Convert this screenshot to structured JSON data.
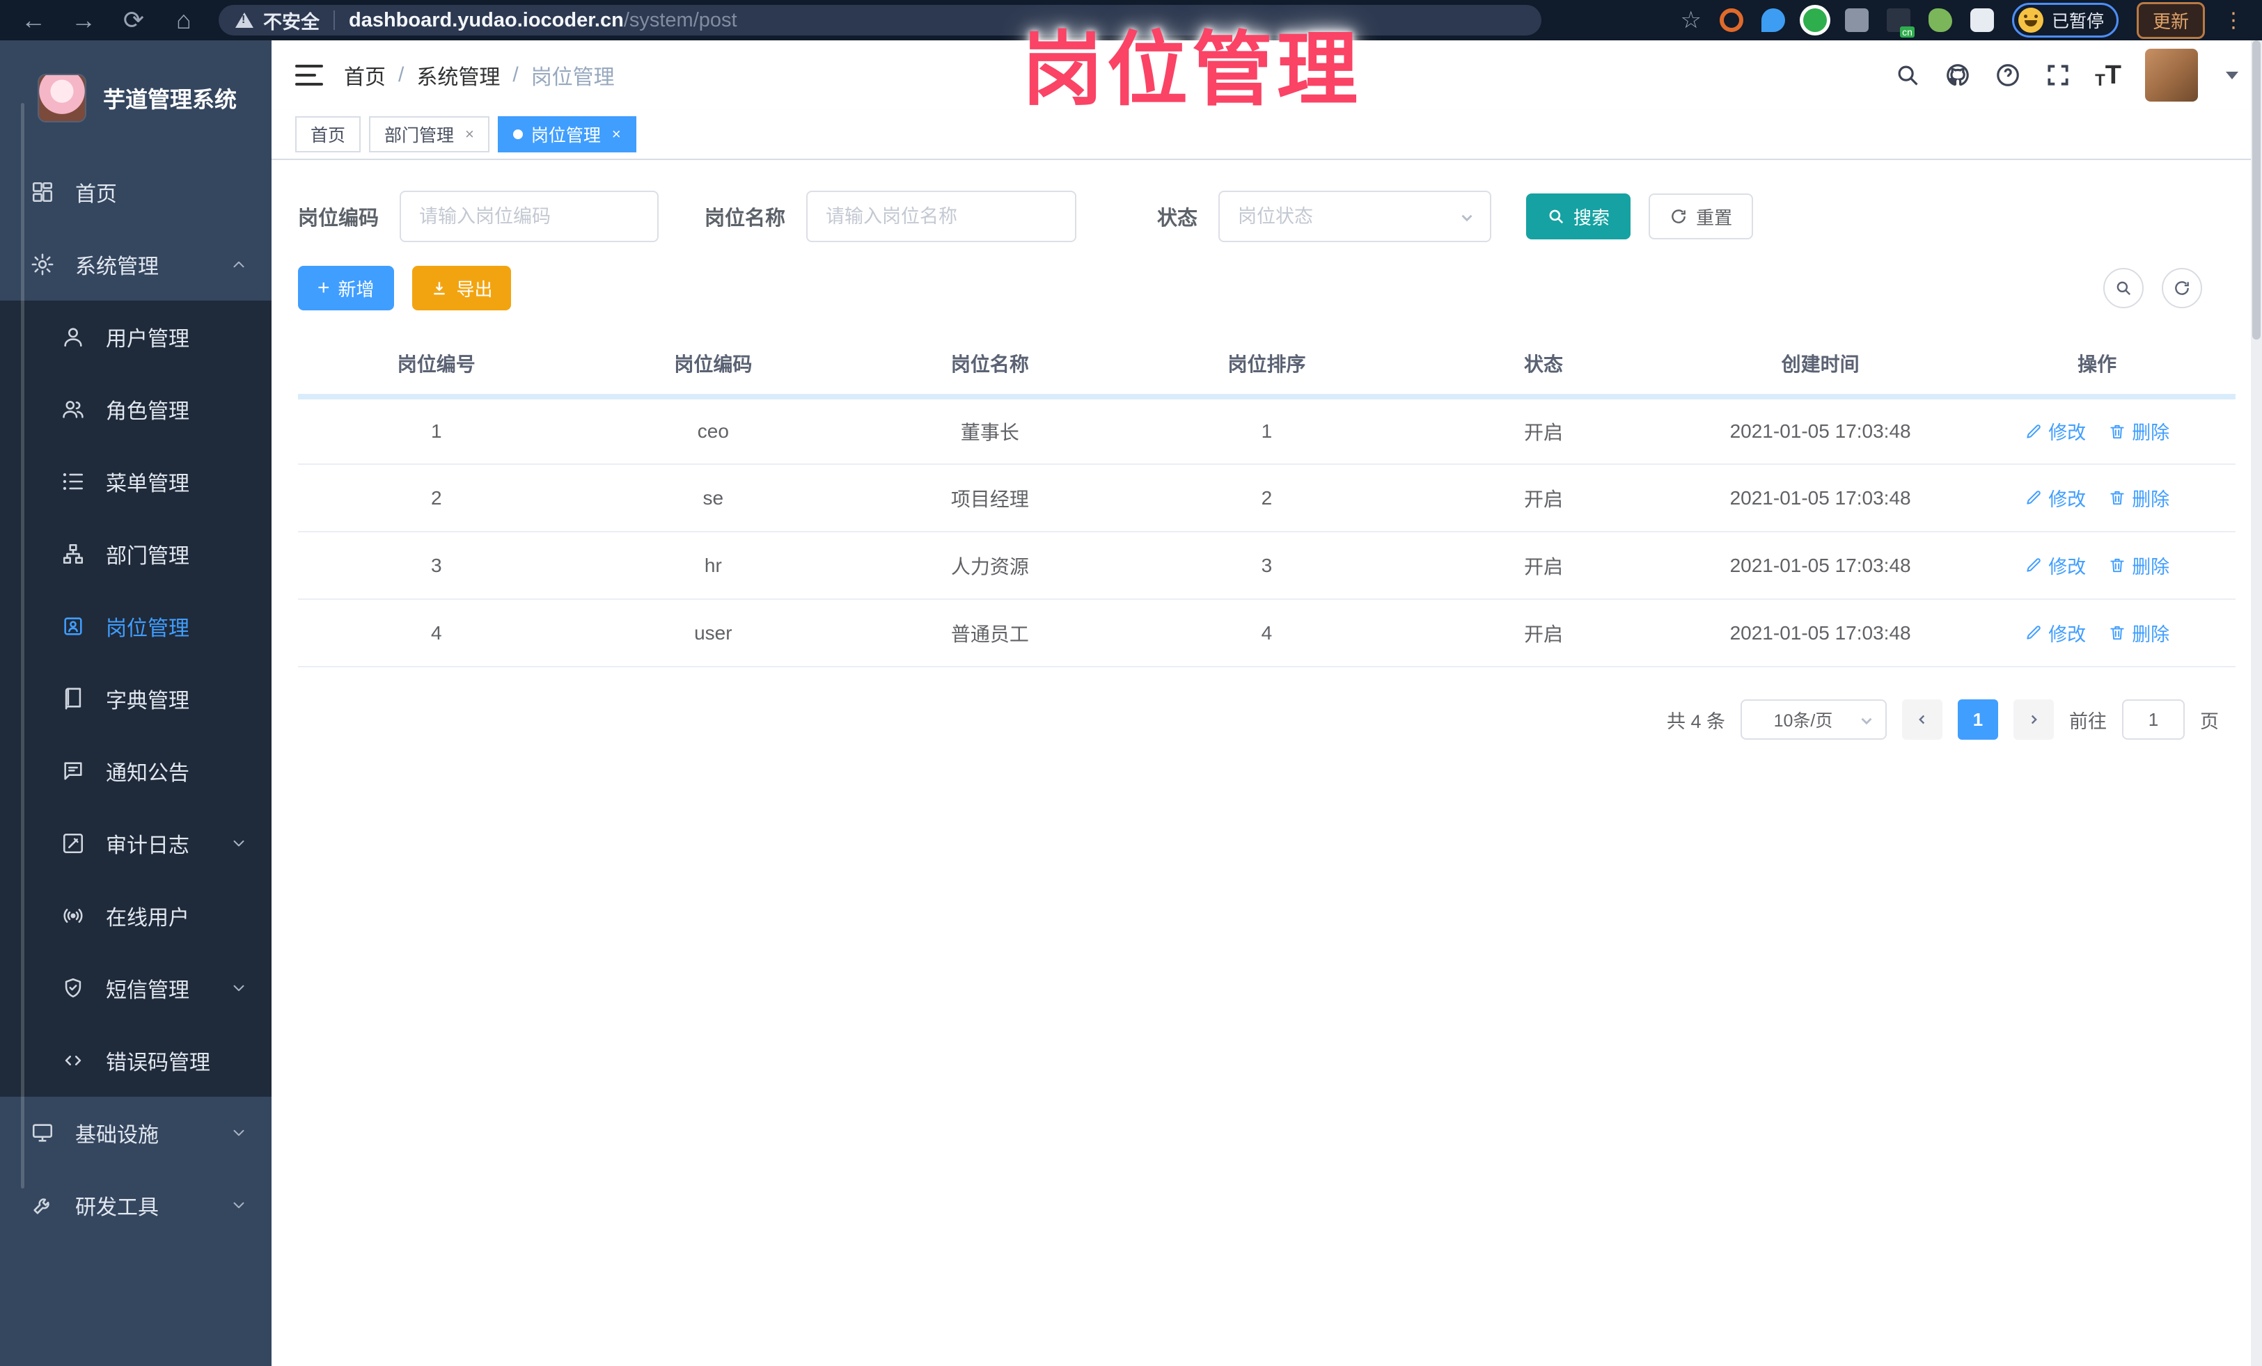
{
  "annotation": {
    "text": "岗位管理",
    "color": "#fa4365"
  },
  "browser": {
    "security_label": "不安全",
    "url_host": "dashboard.yudao.iocoder.cn",
    "url_path": "/system/post",
    "paused_badge": "已暂停",
    "update_button": "更新"
  },
  "sidebar": {
    "logo_title": "芋道管理系统",
    "items": [
      {
        "label": "首页",
        "icon": "dashboard-icon",
        "level": 1
      },
      {
        "label": "系统管理",
        "icon": "gear-icon",
        "level": 1,
        "arrow": "up"
      },
      {
        "label": "用户管理",
        "icon": "user-icon",
        "level": 2
      },
      {
        "label": "角色管理",
        "icon": "role-icon",
        "level": 2
      },
      {
        "label": "菜单管理",
        "icon": "menu-list-icon",
        "level": 2
      },
      {
        "label": "部门管理",
        "icon": "dept-tree-icon",
        "level": 2
      },
      {
        "label": "岗位管理",
        "icon": "post-badge-icon",
        "level": 2,
        "active": true
      },
      {
        "label": "字典管理",
        "icon": "dict-book-icon",
        "level": 2
      },
      {
        "label": "通知公告",
        "icon": "notice-icon",
        "level": 2
      },
      {
        "label": "审计日志",
        "icon": "audit-log-icon",
        "level": 2,
        "arrow": "down"
      },
      {
        "label": "在线用户",
        "icon": "online-user-icon",
        "level": 2
      },
      {
        "label": "短信管理",
        "icon": "sms-shield-icon",
        "level": 2,
        "arrow": "down"
      },
      {
        "label": "错误码管理",
        "icon": "code-icon",
        "level": 2
      },
      {
        "label": "基础设施",
        "icon": "infra-icon",
        "level": 1,
        "arrow": "down"
      },
      {
        "label": "研发工具",
        "icon": "dev-tool-icon",
        "level": 1,
        "arrow": "down"
      }
    ]
  },
  "header": {
    "breadcrumb": [
      "首页",
      "系统管理",
      "岗位管理"
    ]
  },
  "tabs": [
    {
      "label": "首页",
      "closable": false,
      "active": false
    },
    {
      "label": "部门管理",
      "closable": true,
      "active": false
    },
    {
      "label": "岗位管理",
      "closable": true,
      "active": true
    }
  ],
  "filters": {
    "post_code_label": "岗位编码",
    "post_code_placeholder": "请输入岗位编码",
    "post_name_label": "岗位名称",
    "post_name_placeholder": "请输入岗位名称",
    "status_label": "状态",
    "status_placeholder": "岗位状态",
    "search_label": "搜索",
    "reset_label": "重置"
  },
  "toolbar": {
    "add_label": "新增",
    "export_label": "导出"
  },
  "table": {
    "headers": [
      "岗位编号",
      "岗位编码",
      "岗位名称",
      "岗位排序",
      "状态",
      "创建时间",
      "操作"
    ],
    "edit_label": "修改",
    "delete_label": "删除",
    "rows": [
      {
        "id": "1",
        "code": "ceo",
        "name": "董事长",
        "sort": "1",
        "status": "开启",
        "created": "2021-01-05 17:03:48"
      },
      {
        "id": "2",
        "code": "se",
        "name": "项目经理",
        "sort": "2",
        "status": "开启",
        "created": "2021-01-05 17:03:48"
      },
      {
        "id": "3",
        "code": "hr",
        "name": "人力资源",
        "sort": "3",
        "status": "开启",
        "created": "2021-01-05 17:03:48"
      },
      {
        "id": "4",
        "code": "user",
        "name": "普通员工",
        "sort": "4",
        "status": "开启",
        "created": "2021-01-05 17:03:48"
      }
    ]
  },
  "pagination": {
    "total_text": "共 4 条",
    "page_size": "10条/页",
    "current_page": "1",
    "goto_label": "前往",
    "goto_value": "1",
    "page_suffix": "页"
  },
  "colors": {
    "primary": "#409eff",
    "search_button": "#16a2a2",
    "export_button": "#f2a410",
    "sidebar_bg": "#35465f",
    "submenu_bg": "#1f2a3a",
    "annotation": "#fa4365"
  }
}
